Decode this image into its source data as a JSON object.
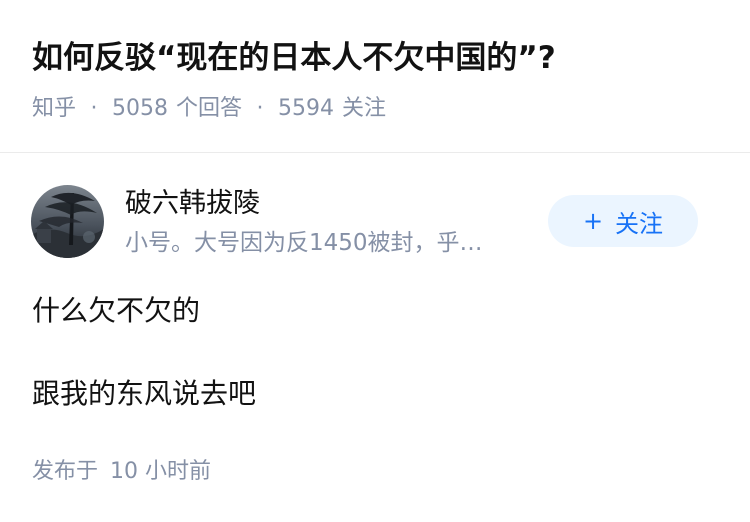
{
  "question": {
    "title": "如何反驳“现在的日本人不欠中国的”?",
    "source": "知乎",
    "separator": "·",
    "answer_count": "5058",
    "answer_label": "个回答",
    "follower_count": "5594",
    "follower_label": "关注"
  },
  "author": {
    "name": "破六韩拔陵",
    "bio": "小号。大号因为反1450被封，乎…",
    "follow_plus": "+",
    "follow_label": "关注"
  },
  "answer": {
    "paragraphs": [
      "什么欠不欠的",
      "跟我的东风说去吧"
    ],
    "published_label": "发布于",
    "published_time": "10 小时前"
  },
  "colors": {
    "text_primary": "#121212",
    "text_secondary": "#8590a6",
    "accent": "#1772f6",
    "button_bg": "#ebf5ff",
    "divider": "#ebebeb"
  }
}
